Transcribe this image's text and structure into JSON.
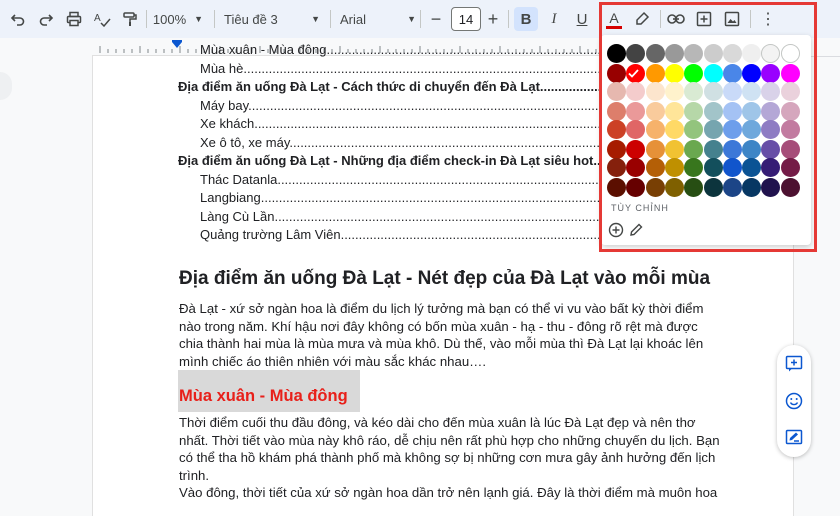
{
  "toolbar": {
    "zoom": "100%",
    "style": "Tiêu đề 3",
    "font": "Arial",
    "font_size": "14",
    "minus": "−",
    "plus": "+",
    "bold": "B",
    "italic": "I",
    "underline": "U",
    "text_color": "A",
    "more": "⋮"
  },
  "toc": [
    {
      "text": "Mùa xuân - Mùa đông",
      "level": "sub"
    },
    {
      "text": "Mùa hè",
      "level": "sub"
    },
    {
      "text": "Địa điểm ăn uống Đà Lạt - Cách thức di chuyển đến Đà Lạt",
      "level": "main"
    },
    {
      "text": "Máy bay",
      "level": "sub"
    },
    {
      "text": "Xe khách",
      "level": "sub"
    },
    {
      "text": "Xe ô tô, xe máy",
      "level": "sub"
    },
    {
      "text": "Địa điểm ăn uống Đà Lạt - Những địa điểm check-in Đà Lạt siêu hot",
      "level": "main"
    },
    {
      "text": "Thác Datanla",
      "level": "sub"
    },
    {
      "text": "Langbiang",
      "level": "sub"
    },
    {
      "text": "Làng Cù Lần",
      "level": "sub"
    },
    {
      "text": "Quảng trường Lâm Viên",
      "level": "sub"
    }
  ],
  "heading": "Địa điểm ăn uống Đà Lạt - Nét đẹp của Đà Lạt vào mỗi mùa",
  "para1": [
    "Đà Lạt - xứ sở ngàn hoa là điểm du lịch lý tưởng mà bạn có thể vi vu vào bất kỳ thời điểm",
    "nào trong năm. Khí hậu nơi đây không có bốn mùa xuân - hạ - thu - đông rõ rệt mà được",
    "chia thành hai mùa là mùa mưa và mùa khô. Dù thế, vào mỗi mùa thì Đà Lạt lại khoác lên",
    "mình chiếc áo thiên nhiên với màu sắc khác nhau…."
  ],
  "subheading": "Mùa xuân - Mùa đông",
  "para2": [
    "Thời điểm cuối thu đầu đông, và kéo dài cho đến mùa xuân là lúc Đà Lạt đẹp và nên thơ",
    "nhất. Thời tiết vào mùa này khô ráo, dễ chịu nên rất phù hợp cho những chuyến du lịch. Bạn",
    "có thể tha hồ khám phá thành phố mà không sợ bị những cơn mưa gây ảnh hưởng đến lịch",
    "trình.",
    "Vào đông, thời tiết của xứ sở ngàn hoa dần trở nên lạnh giá. Đây là thời điểm mà muôn hoa"
  ],
  "palette": {
    "rows": [
      [
        "#000000",
        "#434343",
        "#666666",
        "#999999",
        "#b7b7b7",
        "#cccccc",
        "#d9d9d9",
        "#efefef",
        "#f3f3f3",
        "#ffffff"
      ],
      [
        "#980000",
        "#ff0000",
        "#ff9900",
        "#ffff00",
        "#00ff00",
        "#00ffff",
        "#4a86e8",
        "#0000ff",
        "#9900ff",
        "#ff00ff"
      ],
      [
        "#e6b8af",
        "#f4cccc",
        "#fce5cd",
        "#fff2cc",
        "#d9ead3",
        "#d0e0e3",
        "#c9daf8",
        "#cfe2f3",
        "#d9d2e9",
        "#ead1dc"
      ],
      [
        "#dd7e6b",
        "#ea9999",
        "#f9cb9c",
        "#ffe599",
        "#b6d7a8",
        "#a2c4c9",
        "#a4c2f4",
        "#9fc5e8",
        "#b4a7d6",
        "#d5a6bd"
      ],
      [
        "#cc4125",
        "#e06666",
        "#f6b26b",
        "#ffd966",
        "#93c47d",
        "#76a5af",
        "#6d9eeb",
        "#6fa8dc",
        "#8e7cc3",
        "#c27ba0"
      ],
      [
        "#a61c00",
        "#cc0000",
        "#e69138",
        "#f1c232",
        "#6aa84f",
        "#45818e",
        "#3c78d8",
        "#3d85c6",
        "#674ea7",
        "#a64d79"
      ],
      [
        "#85200c",
        "#990000",
        "#b45f06",
        "#bf9000",
        "#38761d",
        "#134f5c",
        "#1155cc",
        "#0b5394",
        "#351c75",
        "#741b47"
      ],
      [
        "#5b0f00",
        "#660000",
        "#783f04",
        "#7f6000",
        "#274e13",
        "#0c343d",
        "#1c4587",
        "#073763",
        "#20124d",
        "#4c1130"
      ]
    ],
    "selected_color": "#ff0000",
    "custom_label": "TÙY CHỈNH"
  },
  "colors": {
    "highlight_frame": "#e53935",
    "heading_red": "#e8201a",
    "accent": "#0b57d0"
  }
}
